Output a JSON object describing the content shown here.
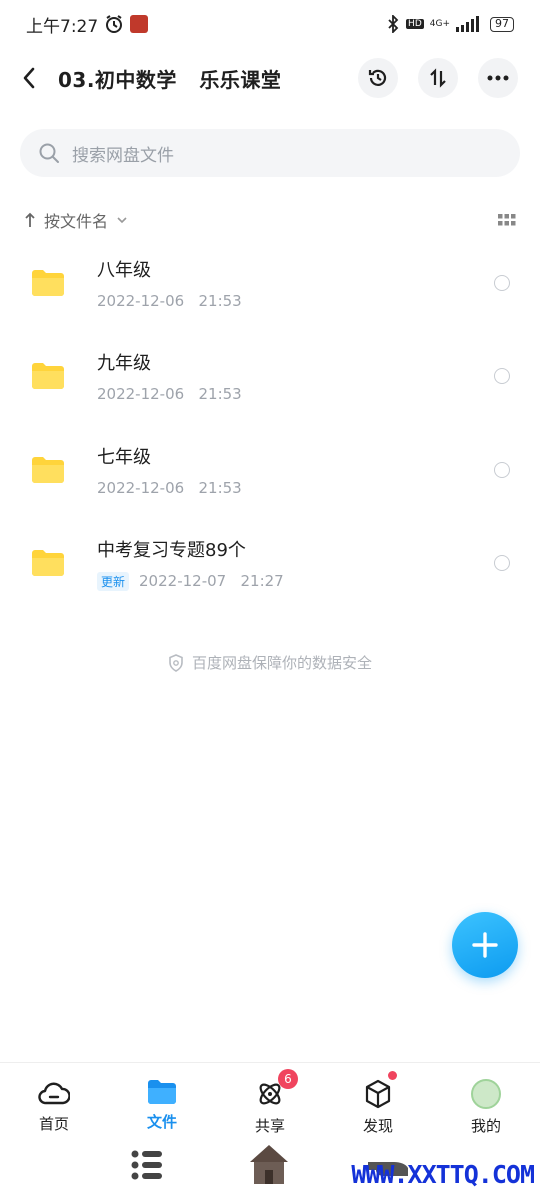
{
  "status_bar": {
    "time": "上午7:27",
    "network": "4G+",
    "hd": "HD",
    "battery": "97"
  },
  "header": {
    "title": "03.初中数学   乐乐课堂"
  },
  "search": {
    "placeholder": "搜索网盘文件"
  },
  "sort": {
    "label": "按文件名"
  },
  "files": [
    {
      "name": "八年级",
      "date": "2022-12-06   21:53",
      "tag": ""
    },
    {
      "name": "九年级",
      "date": "2022-12-06   21:53",
      "tag": ""
    },
    {
      "name": "七年级",
      "date": "2022-12-06   21:53",
      "tag": ""
    },
    {
      "name": "中考复习专题89个",
      "date": "2022-12-07   21:27",
      "tag": "更新"
    }
  ],
  "security_note": "百度网盘保障你的数据安全",
  "tabs": [
    {
      "label": "首页",
      "icon": "cloud-home-icon"
    },
    {
      "label": "文件",
      "icon": "folder-icon"
    },
    {
      "label": "共享",
      "icon": "atom-share-icon",
      "badge": "6"
    },
    {
      "label": "发现",
      "icon": "cube-icon"
    },
    {
      "label": "我的",
      "icon": "avatar"
    }
  ],
  "watermark": "WWW.XXTTQ.COM",
  "colors": {
    "accent": "#1a90ee",
    "folder": "#ffd43b",
    "badge": "#f0445e"
  }
}
